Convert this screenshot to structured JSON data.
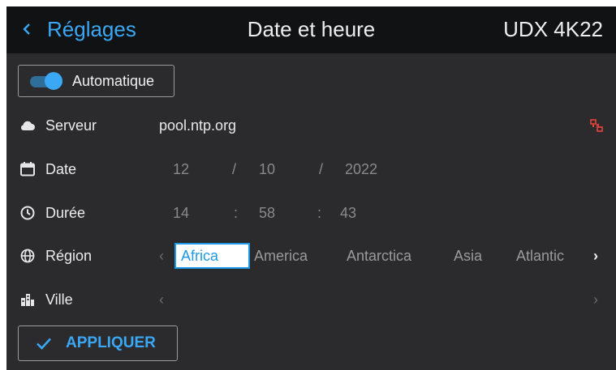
{
  "header": {
    "back_label": "Réglages",
    "title": "Date et heure",
    "device": "UDX 4K22"
  },
  "automatic": {
    "label": "Automatique",
    "enabled": true
  },
  "server": {
    "label": "Serveur",
    "value": "pool.ntp.org"
  },
  "date": {
    "label": "Date",
    "day": "12",
    "month": "10",
    "year": "2022",
    "separator": "/"
  },
  "time": {
    "label": "Durée",
    "hours": "14",
    "minutes": "58",
    "seconds": "43",
    "separator": ":"
  },
  "region": {
    "label": "Région",
    "items": [
      "Africa",
      "America",
      "Antarctica",
      "Asia",
      "Atlantic"
    ],
    "selected": "Africa",
    "prev_arrow": "‹",
    "next_arrow": "›"
  },
  "city": {
    "label": "Ville",
    "prev_arrow": "‹",
    "next_arrow": "›"
  },
  "apply": {
    "label": "APPLIQUER"
  },
  "colors": {
    "accent": "#3aa8f4",
    "header_bg": "#111214",
    "panel_bg": "#2b2b2e",
    "status_error": "#e8433a"
  },
  "icons": {
    "back": "chevron-left-icon",
    "server": "cloud-icon",
    "date": "calendar-icon",
    "time": "clock-icon",
    "region": "globe-icon",
    "city": "city-icon",
    "server_status": "network-disconnected-icon",
    "apply": "check-icon"
  }
}
